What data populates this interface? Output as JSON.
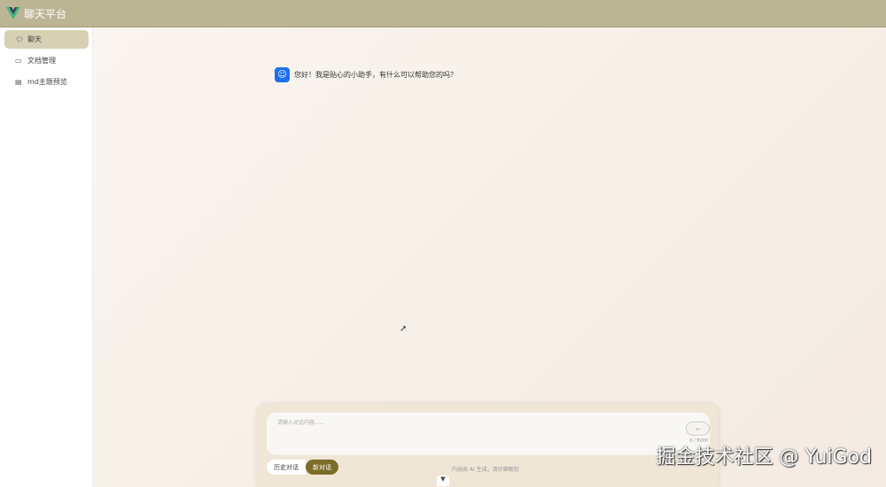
{
  "header": {
    "title": "聊天平台"
  },
  "sidebar": {
    "items": [
      {
        "label": "聊天",
        "icon": "chat-icon",
        "active": true
      },
      {
        "label": "文档管理",
        "icon": "folder-icon"
      },
      {
        "label": "md主题预览",
        "icon": "document-icon"
      }
    ]
  },
  "chat": {
    "messages": [
      {
        "role": "assistant",
        "text": "您好！我是贴心的小助手，有什么可以帮助您的吗？"
      }
    ]
  },
  "composer": {
    "placeholder": "请输入对话内容......",
    "counter": "0 / 8000",
    "history_label": "历史对话",
    "new_label": "新对话",
    "disclaimer": "内容由 AI 生成，请仔细甄别",
    "send_icon": "send-icon"
  },
  "watermark": "掘金技术社区 @ YuiGod"
}
